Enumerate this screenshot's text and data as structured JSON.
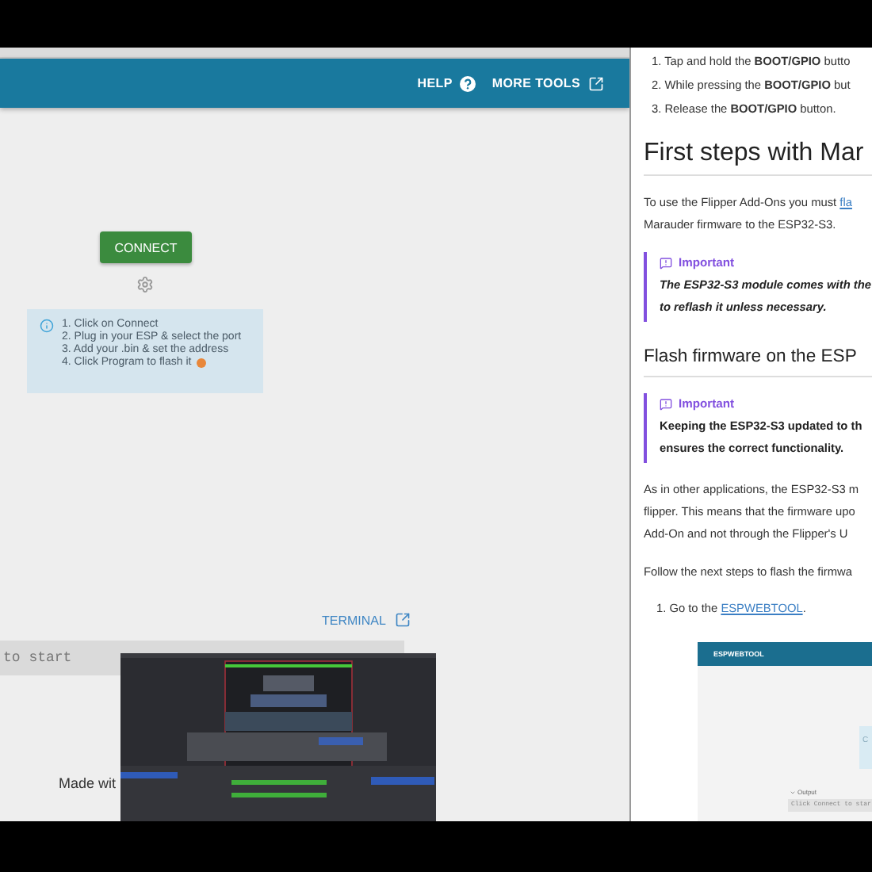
{
  "left_window": {
    "header_links": [
      {
        "label": "HELP",
        "kind": "help"
      },
      {
        "label": "MORE TOOLS",
        "kind": "external"
      }
    ],
    "connect_button": "CONNECT",
    "instructions": [
      "1. Click on Connect",
      "2. Plug in your ESP & select the port",
      "3. Add your .bin & set the address",
      "4. Click Program to flash it"
    ],
    "terminal_link": "TERMINAL",
    "terminal_output": "to start",
    "footer": "Made wit"
  },
  "document": [
    {
      "kind": "list_item",
      "text": "1. Tap and hold the **BOOT/GPIO** butto"
    },
    {
      "kind": "list_item",
      "text": "2. While pressing the **BOOT/GPIO** but"
    },
    {
      "kind": "list_item",
      "text": "3. Release the **BOOT/GPIO** button."
    },
    {
      "kind": "h1",
      "text": "First steps with Mar"
    },
    {
      "kind": "paragraph",
      "lines": [
        [
          {
            "kind": "text",
            "text": "To use the Flipper Add-Ons you must "
          },
          {
            "kind": "link",
            "text": "fla"
          }
        ],
        [
          {
            "kind": "text",
            "text": "Marauder firmware to the ESP32-S3."
          }
        ]
      ]
    },
    {
      "kind": "callout_emphasis",
      "title": "Important",
      "lines": [
        "The ESP32-S3 module comes with the",
        "to reflash it unless necessary."
      ]
    },
    {
      "kind": "h2",
      "text": "Flash firmware on the ESP"
    },
    {
      "kind": "callout",
      "title": "Important",
      "lines": [
        "Keeping the ESP32-S3 updated to th",
        "ensures the correct functionality."
      ]
    },
    {
      "kind": "paragraph",
      "lines": [
        [
          {
            "kind": "text",
            "text": "As in other applications, the ESP32-S3 m"
          }
        ],
        [
          {
            "kind": "text",
            "text": "flipper. This means that the firmware upo"
          }
        ],
        [
          {
            "kind": "text",
            "text": "Add-On and not through the Flipper's U"
          }
        ]
      ]
    },
    {
      "kind": "paragraph",
      "lines": [
        [
          {
            "kind": "text",
            "text": "Follow the next steps to flash the firmwa"
          }
        ]
      ]
    },
    {
      "kind": "step",
      "lines": [
        [
          {
            "kind": "text",
            "text": "1. Go to the "
          },
          {
            "kind": "link",
            "text": "ESPWEBTOOL"
          },
          {
            "kind": "text",
            "text": "."
          }
        ]
      ]
    },
    {
      "kind": "screenshot",
      "header": "ESPWEBTOOL",
      "card_text": "C",
      "output_label": "Output",
      "output_text": "Click Connect to star"
    }
  ]
}
